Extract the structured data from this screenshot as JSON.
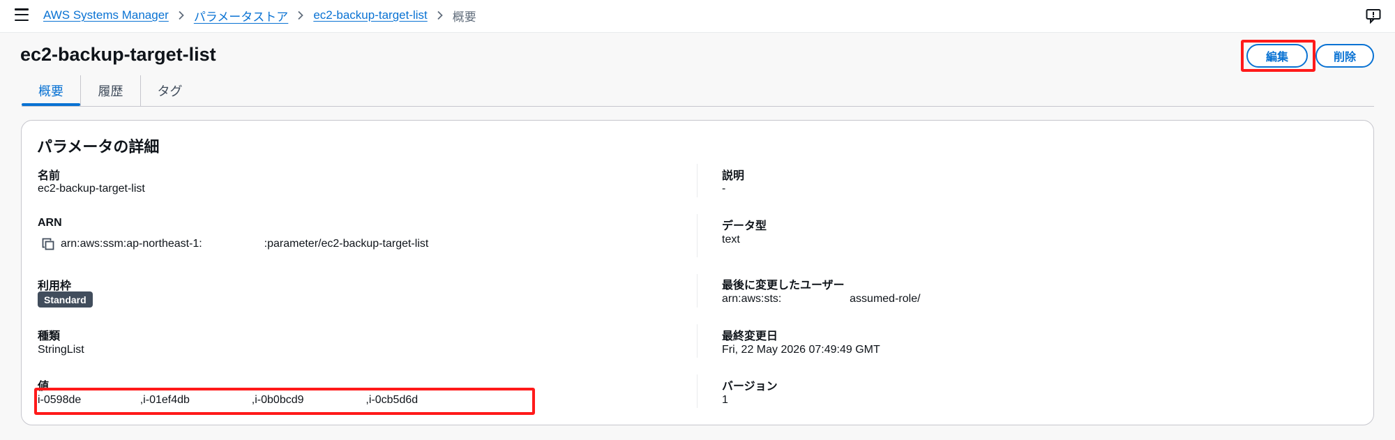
{
  "breadcrumb": {
    "items": [
      "AWS Systems Manager",
      "パラメータストア",
      "ec2-backup-target-list"
    ],
    "current": "概要"
  },
  "icons": {
    "menu": "hamburger-menu-icon",
    "separator": "chevron-right-icon",
    "help": "feedback-icon",
    "copy": "copy-icon"
  },
  "header": {
    "title": "ec2-backup-target-list",
    "edit_label": "編集",
    "delete_label": "削除"
  },
  "tabs": [
    {
      "label": "概要",
      "active": true
    },
    {
      "label": "履歴",
      "active": false
    },
    {
      "label": "タグ",
      "active": false
    }
  ],
  "details": {
    "title": "パラメータの詳細",
    "left": {
      "name": {
        "label": "名前",
        "value": "ec2-backup-target-list"
      },
      "arn": {
        "label": "ARN",
        "value": "arn:aws:ssm:ap-northeast-1:                    :parameter/ec2-backup-target-list"
      },
      "tier": {
        "label": "利用枠",
        "value": "Standard"
      },
      "type": {
        "label": "種類",
        "value": "StringList"
      },
      "value": {
        "label": "値",
        "value": "i-0598de                   ,i-01ef4db                    ,i-0b0bcd9                    ,i-0cb5d6d"
      }
    },
    "right": {
      "description": {
        "label": "説明",
        "value": "-"
      },
      "data_type": {
        "label": "データ型",
        "value": "text"
      },
      "last_modified_user": {
        "label": "最後に変更したユーザー",
        "value": "arn:aws:sts:                      assumed-role/"
      },
      "last_modified_date": {
        "label": "最終変更日",
        "value": "Fri, 22 May 2026 07:49:49 GMT"
      },
      "version": {
        "label": "バージョン",
        "value": "1"
      }
    }
  },
  "colors": {
    "link": "#0972d3",
    "annotation": "#ff1a1a",
    "badge": "#414d5c"
  }
}
